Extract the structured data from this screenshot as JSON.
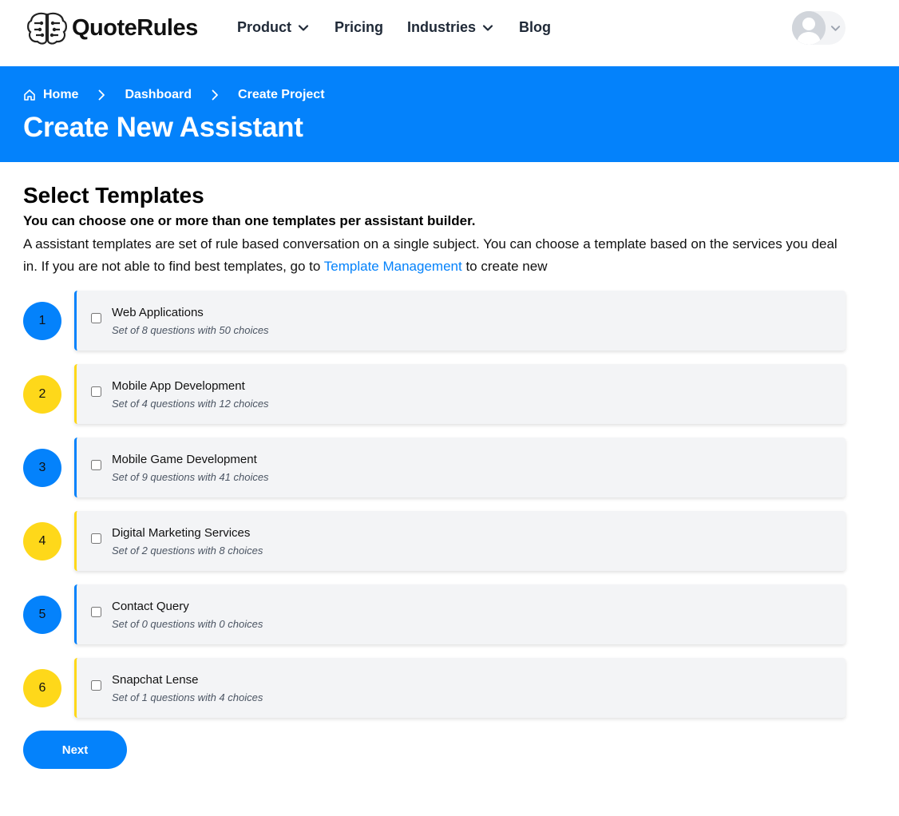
{
  "brand": {
    "name": "QuoteRules"
  },
  "nav": {
    "items": [
      {
        "label": "Product",
        "has_dropdown": true
      },
      {
        "label": "Pricing",
        "has_dropdown": false
      },
      {
        "label": "Industries",
        "has_dropdown": true
      },
      {
        "label": "Blog",
        "has_dropdown": false
      }
    ]
  },
  "breadcrumb": [
    {
      "label": "Home",
      "icon": "home-icon"
    },
    {
      "label": "Dashboard"
    },
    {
      "label": "Create Project"
    }
  ],
  "page": {
    "title": "Create New Assistant"
  },
  "section": {
    "title": "Select Templates",
    "subhead": "You can choose one or more than one templates per assistant builder.",
    "desc_before": "A assistant templates are set of rule based conversation on a single subject. You can choose a template based on the services you deal in. If you are not able to find best templates, go to",
    "link_label": "Template Management",
    "desc_after": "to create new"
  },
  "templates": [
    {
      "number": "1",
      "name": "Web Applications",
      "summary": "Set of 8 questions with 50 choices",
      "accent": "blue",
      "checked": false
    },
    {
      "number": "2",
      "name": "Mobile App Development",
      "summary": "Set of 4 questions with 12 choices",
      "accent": "yellow",
      "checked": false
    },
    {
      "number": "3",
      "name": "Mobile Game Development",
      "summary": "Set of 9 questions with 41 choices",
      "accent": "blue",
      "checked": false
    },
    {
      "number": "4",
      "name": "Digital Marketing Services",
      "summary": "Set of 2 questions with 8 choices",
      "accent": "yellow",
      "checked": false
    },
    {
      "number": "5",
      "name": "Contact Query",
      "summary": "Set of 0 questions with 0 choices",
      "accent": "blue",
      "checked": false
    },
    {
      "number": "6",
      "name": "Snapchat Lense",
      "summary": "Set of 1 questions with 4 choices",
      "accent": "yellow",
      "checked": false
    }
  ],
  "actions": {
    "next_label": "Next"
  },
  "colors": {
    "primary": "#0482fb",
    "accent_yellow": "#fed81a",
    "card_bg": "#f3f4f6"
  }
}
